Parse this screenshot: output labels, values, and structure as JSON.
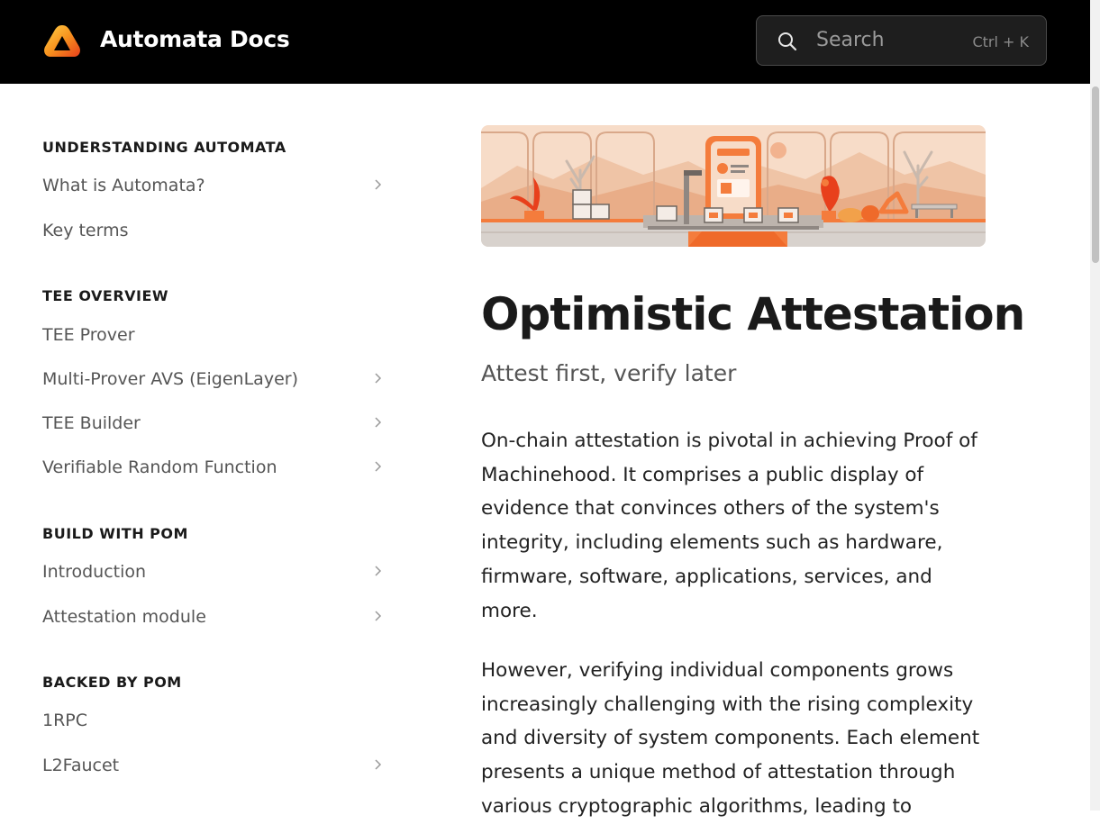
{
  "header": {
    "brand": "Automata Docs",
    "logo_icon": "automata-logo-icon",
    "search": {
      "placeholder": "Search",
      "shortcut": "Ctrl + K",
      "icon": "search-icon"
    },
    "colors": {
      "background": "#000000",
      "brand_text": "#ffffff",
      "logo_accent": "#f39c12"
    }
  },
  "sidebar": {
    "sections": [
      {
        "title": "UNDERSTANDING AUTOMATA",
        "items": [
          {
            "label": "What is Automata?",
            "expandable": true
          },
          {
            "label": "Key terms",
            "expandable": false
          }
        ]
      },
      {
        "title": "TEE OVERVIEW",
        "items": [
          {
            "label": "TEE Prover",
            "expandable": false
          },
          {
            "label": "Multi-Prover AVS (EigenLayer)",
            "expandable": true
          },
          {
            "label": "TEE Builder",
            "expandable": true
          },
          {
            "label": "Verifiable Random Function",
            "expandable": true
          }
        ]
      },
      {
        "title": "BUILD WITH POM",
        "items": [
          {
            "label": "Introduction",
            "expandable": true
          },
          {
            "label": "Attestation module",
            "expandable": true
          }
        ]
      },
      {
        "title": "BACKED BY POM",
        "items": [
          {
            "label": "1RPC",
            "expandable": false
          },
          {
            "label": "L2Faucet",
            "expandable": true
          }
        ]
      }
    ]
  },
  "main": {
    "title": "Optimistic Attestation",
    "subtitle": "Attest first, verify later",
    "paragraphs": [
      "On-chain attestation is pivotal in achieving Proof of Machinehood. It comprises a public display of evidence that convinces others of the system's integrity, including elements such as hardware, firmware, software, applications, services, and more.",
      "However, verifying individual components grows increasingly challenging with the rising complexity and diversity of system components. Each element presents a unique method of attestation through various cryptographic algorithms, leading to"
    ],
    "banner_colors": {
      "primary": "#f47c3c",
      "background": "#f7dcc8"
    }
  }
}
